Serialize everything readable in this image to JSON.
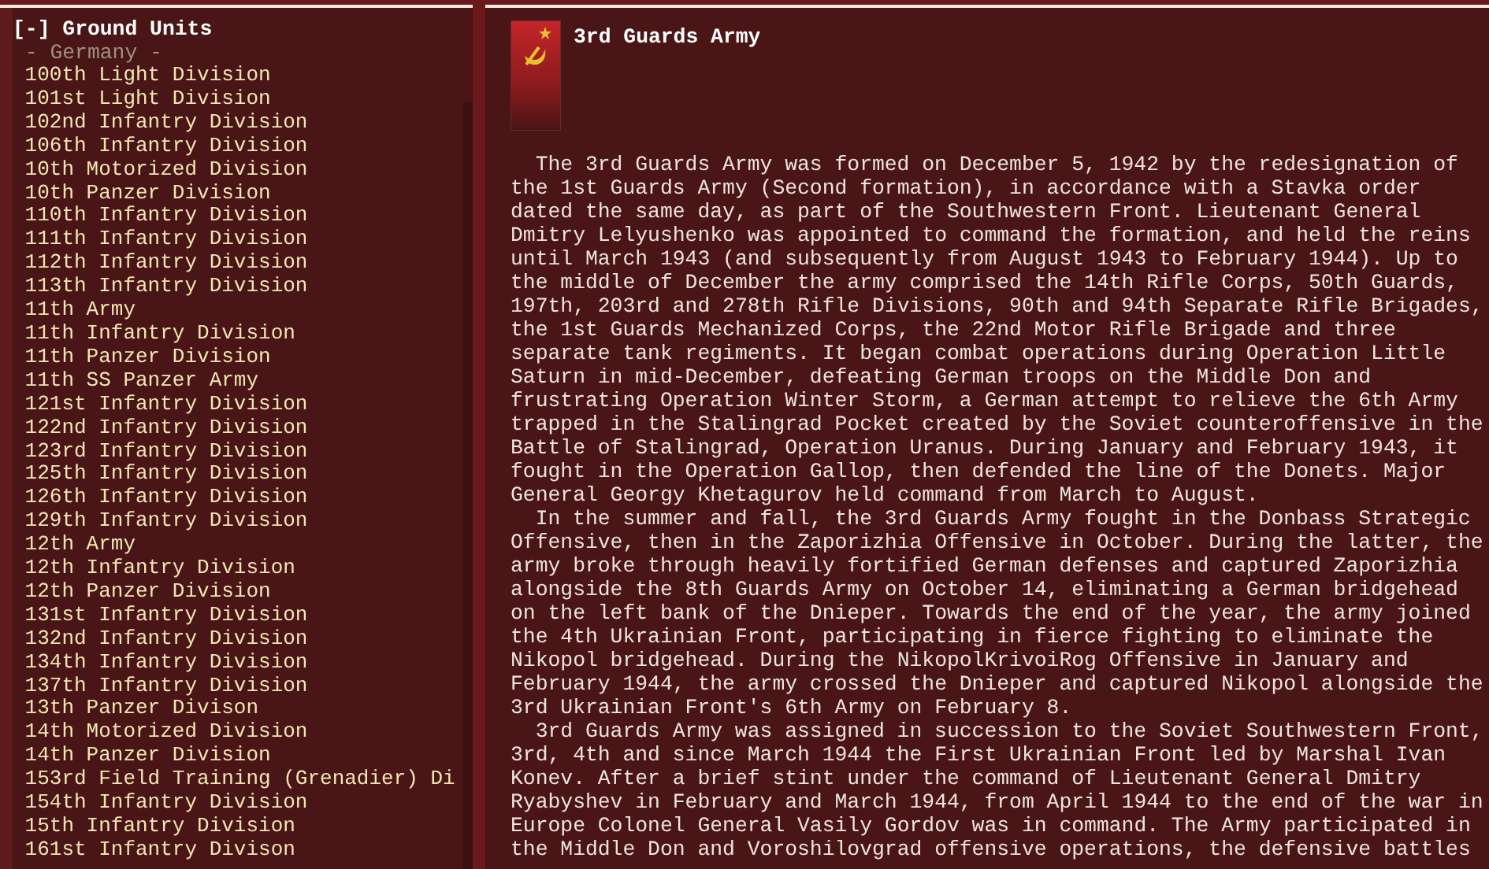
{
  "tree": {
    "toggle": "[-]",
    "title": "Ground Units",
    "expanded": true,
    "group": "- Germany -",
    "items": [
      "100th Light Division",
      "101st Light Division",
      "102nd Infantry Division",
      "106th Infantry Division",
      "10th Motorized Division",
      "10th Panzer Division",
      "110th Infantry Division",
      "111th Infantry Division",
      "112th Infantry Division",
      "113th Infantry Division",
      "11th Army",
      "11th Infantry Division",
      "11th Panzer Division",
      "11th SS Panzer Army",
      "121st Infantry Division",
      "122nd Infantry Division",
      "123rd Infantry Division",
      "125th Infantry Division",
      "126th Infantry Division",
      "129th Infantry Division",
      "12th Army",
      "12th Infantry Division",
      "12th Panzer Division",
      "131st Infantry Division",
      "132nd Infantry Division",
      "134th Infantry Division",
      "137th Infantry Division",
      "13th Panzer Divison",
      "14th Motorized Division",
      "14th Panzer Division",
      "153rd Field Training (Grenadier) Di",
      "154th Infantry Division",
      "15th Infantry Division",
      "161st Infantry Divison"
    ]
  },
  "article": {
    "title": "3rd Guards Army",
    "paragraphs": [
      "The 3rd Guards Army was formed on December 5, 1942 by the redesignation of the 1st Guards Army (Second formation), in accordance with a Stavka order dated the same day, as part of the Southwestern Front. Lieutenant General Dmitry Lelyushenko was appointed to command the formation, and held the reins until March 1943 (and subsequently from August 1943 to February 1944). Up to the middle of December the army comprised the 14th Rifle Corps, 50th Guards, 197th, 203rd and 278th Rifle Divisions, 90th and 94th Separate Rifle Brigades, the 1st Guards Mechanized Corps, the 22nd Motor Rifle Brigade and three separate tank regiments. It began combat operations during Operation Little Saturn in mid-December, defeating German troops on the Middle Don and frustrating Operation Winter Storm, a German attempt to relieve the 6th Army trapped in the Stalingrad Pocket created by the Soviet counteroffensive in the Battle of Stalingrad, Operation Uranus. During January and February 1943, it fought in the Operation Gallop, then defended the line of the Donets. Major General Georgy Khetagurov held command from March to August.",
      "In the summer and fall, the 3rd Guards Army fought in the Donbass Strategic Offensive, then in the Zaporizhia Offensive in October. During the latter, the army broke through heavily fortified German defenses and captured Zaporizhia alongside the 8th Guards Army on October 14, eliminating a German bridgehead on the left bank of the Dnieper. Towards the end of the year, the army joined the 4th Ukrainian Front, participating in fierce fighting to eliminate the Nikopol bridgehead. During the NikopolKrivoiRog Offensive in January and February 1944, the army crossed the Dnieper and captured Nikopol alongside the 3rd Ukrainian Front's 6th Army on February 8.",
      "3rd Guards Army was assigned in succession to the Soviet Southwestern Front, 3rd, 4th and since March 1944 the First Ukrainian Front led by Marshal Ivan Konev. After a brief stint under the command of Lieutenant General Dmitry Ryabyshev in February and March 1944, from April 1944 to the end of the war in Europe Colonel General Vasily Gordov was in command. The Army participated in the Middle Don and Voroshilovgrad offensive operations, the defensive battles"
    ]
  }
}
